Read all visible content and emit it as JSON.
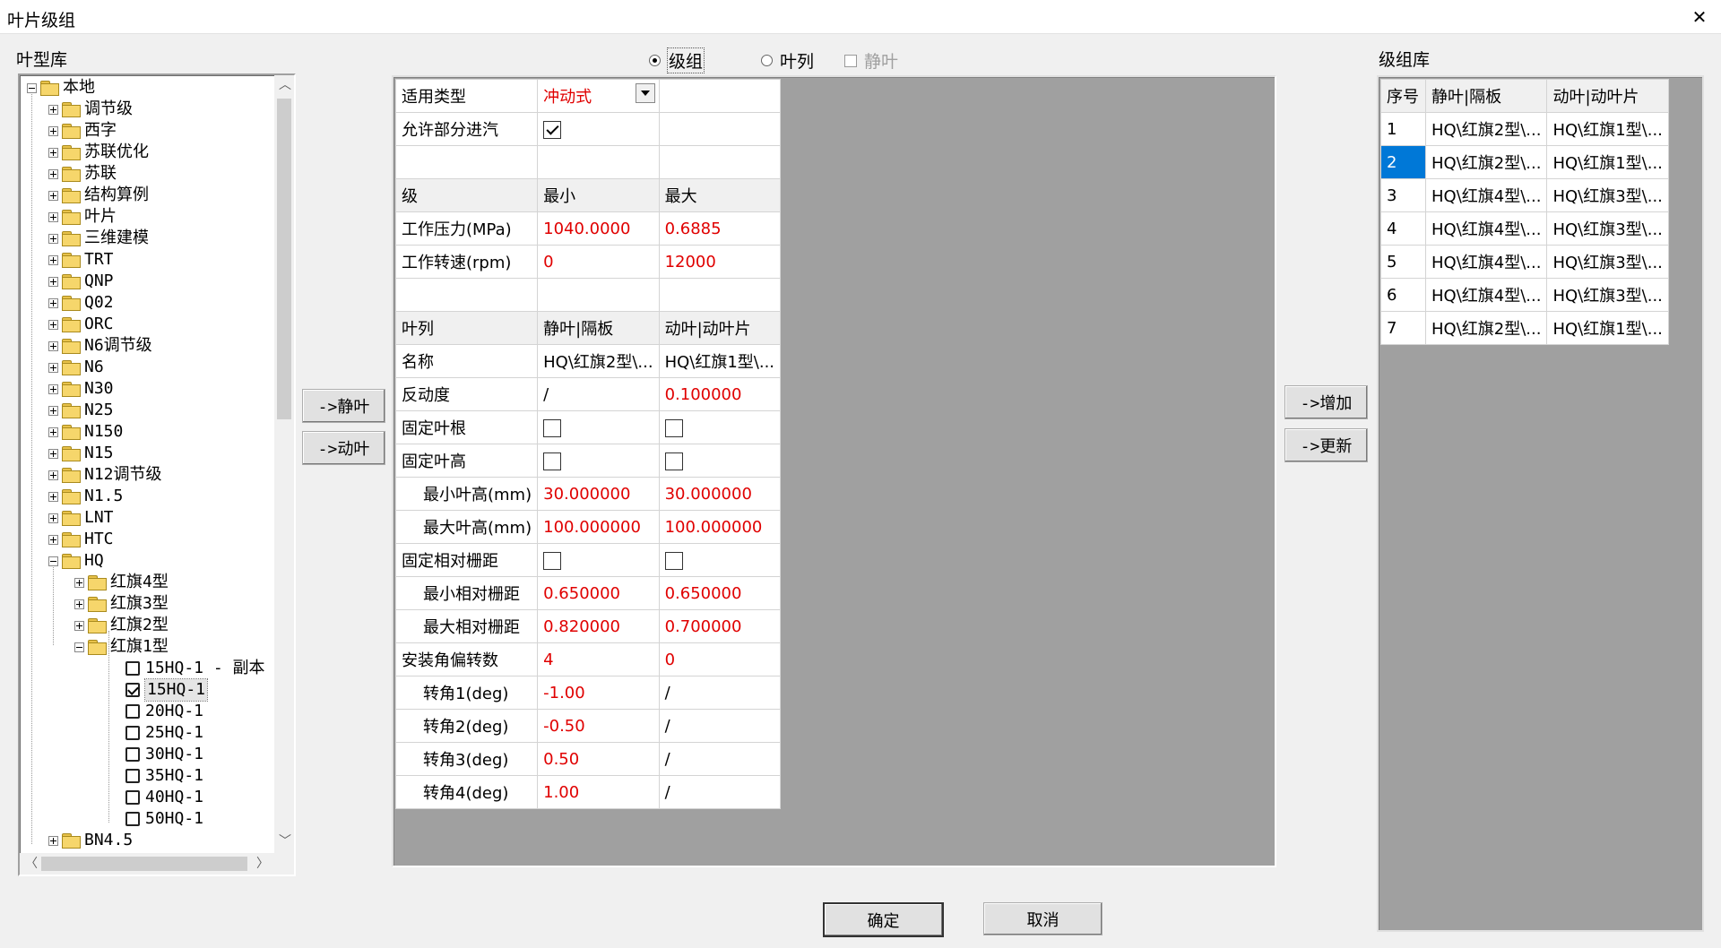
{
  "window": {
    "title": "叶片级组",
    "close_glyph": "✕"
  },
  "labels": {
    "blade_library": "叶型库",
    "stage_library": "级组库"
  },
  "mode": {
    "stage_group": "级组",
    "blade_row": "叶列",
    "stator": "静叶",
    "selected": "stage_group"
  },
  "tree": {
    "root": "本地",
    "folders": [
      "调节级",
      "西字",
      "苏联优化",
      "苏联",
      "结构算例",
      "叶片",
      "三维建模",
      "TRT",
      "QNP",
      "Q02",
      "ORC",
      "N6调节级",
      "N6",
      "N30",
      "N25",
      "N150",
      "N15",
      "N12调节级",
      "N1.5",
      "LNT",
      "HTC"
    ],
    "hq": "HQ",
    "hq_children": [
      "红旗4型",
      "红旗3型",
      "红旗2型"
    ],
    "hq1": "红旗1型",
    "hq1_items": [
      "15HQ-1 - 副本",
      "15HQ-1",
      "20HQ-1",
      "25HQ-1",
      "30HQ-1",
      "35HQ-1",
      "40HQ-1",
      "50HQ-1"
    ],
    "hq1_checked_index": 1,
    "last": "BN4.5"
  },
  "buttons": {
    "to_stator": "->静叶",
    "to_rotor": "->动叶",
    "add": "->增加",
    "update": "->更新",
    "ok": "确定",
    "cancel": "取消"
  },
  "props": {
    "type_label": "适用类型",
    "type_value": "冲动式",
    "partial_admission_label": "允许部分进汽",
    "partial_admission": true,
    "stage_hdr": [
      "级",
      "最小",
      "最大"
    ],
    "pressure": [
      "工作压力(MPa)",
      "1040.0000",
      "0.6885"
    ],
    "speed": [
      "工作转速(rpm)",
      "0",
      "12000"
    ],
    "row_hdr": [
      "叶列",
      "静叶|隔板",
      "动叶|动叶片"
    ],
    "name": [
      "名称",
      "HQ\\红旗2型\\...",
      "HQ\\红旗1型\\..."
    ],
    "reaction": [
      "反动度",
      "/",
      "0.100000"
    ],
    "fix_root": "固定叶根",
    "fix_height": "固定叶高",
    "min_height": [
      "最小叶高(mm)",
      "30.000000",
      "30.000000"
    ],
    "max_height": [
      "最大叶高(mm)",
      "100.000000",
      "100.000000"
    ],
    "fix_pitch": "固定相对栅距",
    "min_pitch": [
      "最小相对栅距",
      "0.650000",
      "0.650000"
    ],
    "max_pitch": [
      "最大相对栅距",
      "0.820000",
      "0.700000"
    ],
    "angle_count": [
      "安装角偏转数",
      "4",
      "0"
    ],
    "turn1": [
      "转角1(deg)",
      "-1.00",
      "/"
    ],
    "turn2": [
      "转角2(deg)",
      "-0.50",
      "/"
    ],
    "turn3": [
      "转角3(deg)",
      "0.50",
      "/"
    ],
    "turn4": [
      "转角4(deg)",
      "1.00",
      "/"
    ]
  },
  "stage_list": {
    "headers": [
      "序号",
      "静叶|隔板",
      "动叶|动叶片"
    ],
    "rows": [
      [
        "1",
        "HQ\\红旗2型\\...",
        "HQ\\红旗1型\\..."
      ],
      [
        "2",
        "HQ\\红旗2型\\...",
        "HQ\\红旗1型\\..."
      ],
      [
        "3",
        "HQ\\红旗4型\\...",
        "HQ\\红旗3型\\..."
      ],
      [
        "4",
        "HQ\\红旗4型\\...",
        "HQ\\红旗3型\\..."
      ],
      [
        "5",
        "HQ\\红旗4型\\...",
        "HQ\\红旗3型\\..."
      ],
      [
        "6",
        "HQ\\红旗4型\\...",
        "HQ\\红旗3型\\..."
      ],
      [
        "7",
        "HQ\\红旗2型\\...",
        "HQ\\红旗1型\\..."
      ]
    ],
    "selected_row": 1
  },
  "colors": {
    "required": "#e00000",
    "selection": "#0078d7",
    "grid_bg": "#a0a0a0"
  }
}
